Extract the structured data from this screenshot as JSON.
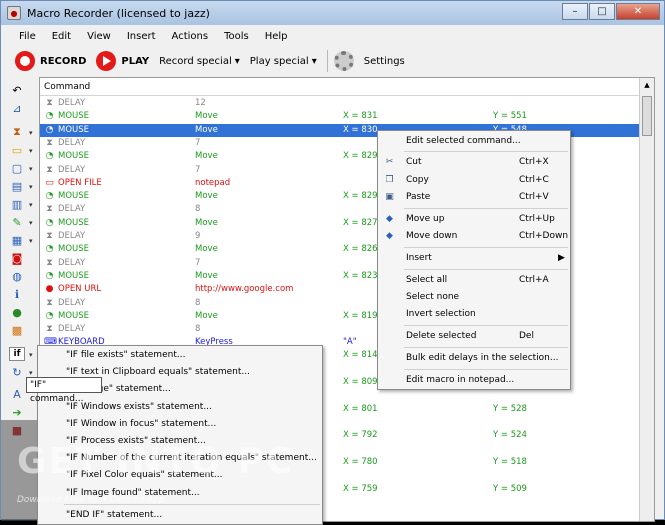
{
  "window": {
    "title": "Macro Recorder (licensed to jazz)",
    "minimize": "–",
    "maximize": "□",
    "close": "✕"
  },
  "menu": [
    "File",
    "Edit",
    "View",
    "Insert",
    "Actions",
    "Tools",
    "Help"
  ],
  "toolbar": {
    "record": "RECORD",
    "play": "PLAY",
    "record_special": "Record special",
    "play_special": "Play special",
    "settings": "Settings"
  },
  "list": {
    "header": "Command",
    "rows": [
      {
        "cmd": "DELAY",
        "action": "",
        "val": "12",
        "x": "",
        "y": "",
        "color": "#888888",
        "icon": "hourglass-icon",
        "glyph": "⧗"
      },
      {
        "cmd": "MOUSE",
        "action": "Move",
        "val": "",
        "x": "X = 831",
        "y": "Y = 551",
        "color": "#1a9a1a",
        "icon": "mouse-icon",
        "glyph": "◔"
      },
      {
        "cmd": "MOUSE",
        "action": "Move",
        "val": "",
        "x": "X = 830",
        "y": "Y = 548",
        "color": "#1a9a1a",
        "icon": "mouse-icon",
        "glyph": "◔",
        "selected": true
      },
      {
        "cmd": "DELAY",
        "action": "",
        "val": "7",
        "x": "",
        "y": "",
        "color": "#888888",
        "icon": "hourglass-icon",
        "glyph": "⧗"
      },
      {
        "cmd": "MOUSE",
        "action": "Move",
        "val": "",
        "x": "X = 829",
        "y": "",
        "color": "#1a9a1a",
        "icon": "mouse-icon",
        "glyph": "◔"
      },
      {
        "cmd": "DELAY",
        "action": "",
        "val": "7",
        "x": "",
        "y": "",
        "color": "#888888",
        "icon": "hourglass-icon",
        "glyph": "⧗"
      },
      {
        "cmd": "OPEN FILE",
        "action": "notepad",
        "val": "",
        "x": "",
        "y": "",
        "color": "#e01010",
        "icon": "folder-icon",
        "glyph": "▭"
      },
      {
        "cmd": "MOUSE",
        "action": "Move",
        "val": "",
        "x": "X = 829",
        "y": "",
        "color": "#1a9a1a",
        "icon": "mouse-icon",
        "glyph": "◔"
      },
      {
        "cmd": "DELAY",
        "action": "",
        "val": "8",
        "x": "",
        "y": "",
        "color": "#888888",
        "icon": "hourglass-icon",
        "glyph": "⧗"
      },
      {
        "cmd": "MOUSE",
        "action": "Move",
        "val": "",
        "x": "X = 827",
        "y": "",
        "color": "#1a9a1a",
        "icon": "mouse-icon",
        "glyph": "◔"
      },
      {
        "cmd": "DELAY",
        "action": "",
        "val": "9",
        "x": "",
        "y": "",
        "color": "#888888",
        "icon": "hourglass-icon",
        "glyph": "⧗"
      },
      {
        "cmd": "MOUSE",
        "action": "Move",
        "val": "",
        "x": "X = 826",
        "y": "",
        "color": "#1a9a1a",
        "icon": "mouse-icon",
        "glyph": "◔"
      },
      {
        "cmd": "DELAY",
        "action": "",
        "val": "7",
        "x": "",
        "y": "",
        "color": "#888888",
        "icon": "hourglass-icon",
        "glyph": "⧗"
      },
      {
        "cmd": "MOUSE",
        "action": "Move",
        "val": "",
        "x": "X = 823",
        "y": "",
        "color": "#1a9a1a",
        "icon": "mouse-icon",
        "glyph": "◔"
      },
      {
        "cmd": "OPEN URL",
        "action": "http://www.google.com",
        "val": "",
        "x": "",
        "y": "",
        "color": "#e01010",
        "icon": "globe-icon",
        "glyph": "●"
      },
      {
        "cmd": "DELAY",
        "action": "",
        "val": "8",
        "x": "",
        "y": "",
        "color": "#888888",
        "icon": "hourglass-icon",
        "glyph": "⧗"
      },
      {
        "cmd": "MOUSE",
        "action": "Move",
        "val": "",
        "x": "X = 819",
        "y": "",
        "color": "#1a9a1a",
        "icon": "mouse-icon",
        "glyph": "◔"
      },
      {
        "cmd": "DELAY",
        "action": "",
        "val": "8",
        "x": "",
        "y": "",
        "color": "#888888",
        "icon": "hourglass-icon",
        "glyph": "⧗"
      },
      {
        "cmd": "KEYBOARD",
        "action": "KeyPress",
        "val": "",
        "x": "\"A\"",
        "y": "",
        "color": "#1a1ae0",
        "icon": "keyboard-icon",
        "glyph": "⌨"
      }
    ],
    "extra_x": [
      "X = 814",
      "X = 809",
      "X = 801",
      "X = 792",
      "X = 780",
      "X = 759"
    ],
    "extra_y": [
      "",
      "",
      "Y = 528",
      "Y = 524",
      "Y = 518",
      "Y = 509"
    ]
  },
  "context_menu": {
    "items": [
      {
        "label": "Edit selected command...",
        "shortcut": "",
        "icon": ""
      },
      {
        "label": "Cut",
        "shortcut": "Ctrl+X",
        "icon": "scissors-icon",
        "glyph": "✂"
      },
      {
        "label": "Copy",
        "shortcut": "Ctrl+C",
        "icon": "copy-icon",
        "glyph": "❐"
      },
      {
        "label": "Paste",
        "shortcut": "Ctrl+V",
        "icon": "paste-icon",
        "glyph": "▣"
      },
      {
        "label": "Move up",
        "shortcut": "Ctrl+Up",
        "icon": "arrow-up-icon",
        "glyph": "◆"
      },
      {
        "label": "Move down",
        "shortcut": "Ctrl+Down",
        "icon": "arrow-down-icon",
        "glyph": "◆"
      },
      {
        "label": "Insert",
        "shortcut": "▶",
        "icon": ""
      },
      {
        "label": "Select all",
        "shortcut": "Ctrl+A",
        "icon": ""
      },
      {
        "label": "Select none",
        "shortcut": "",
        "icon": ""
      },
      {
        "label": "Invert selection",
        "shortcut": "",
        "icon": ""
      },
      {
        "label": "Delete selected",
        "shortcut": "Del",
        "icon": ""
      },
      {
        "label": "Bulk edit delays in the selection...",
        "shortcut": "",
        "icon": ""
      },
      {
        "label": "Edit macro in notepad...",
        "shortcut": "",
        "icon": ""
      }
    ]
  },
  "if_menu": {
    "items": [
      "\"IF file exists\" statement...",
      "\"IF text in Clipboard equals\" statement...",
      "\"IF image\" statement...",
      "\"IF Windows exists\" statement...",
      "\"IF Window in focus\" statement...",
      "\"IF Process exists\" statement...",
      "\"IF Number of the current iteration equals\" statement...",
      "\"IF Pixel Color equals\" statement...",
      "\"IF Image found\" statement...",
      "\"END IF\" statement..."
    ],
    "tooltip": "\"IF\" command..."
  },
  "watermark": {
    "main": "GET INTO PC",
    "sub": "Download Free Your Desired App"
  },
  "colors": {
    "accent": "#3172d6",
    "record_red": "#e21a1a"
  }
}
